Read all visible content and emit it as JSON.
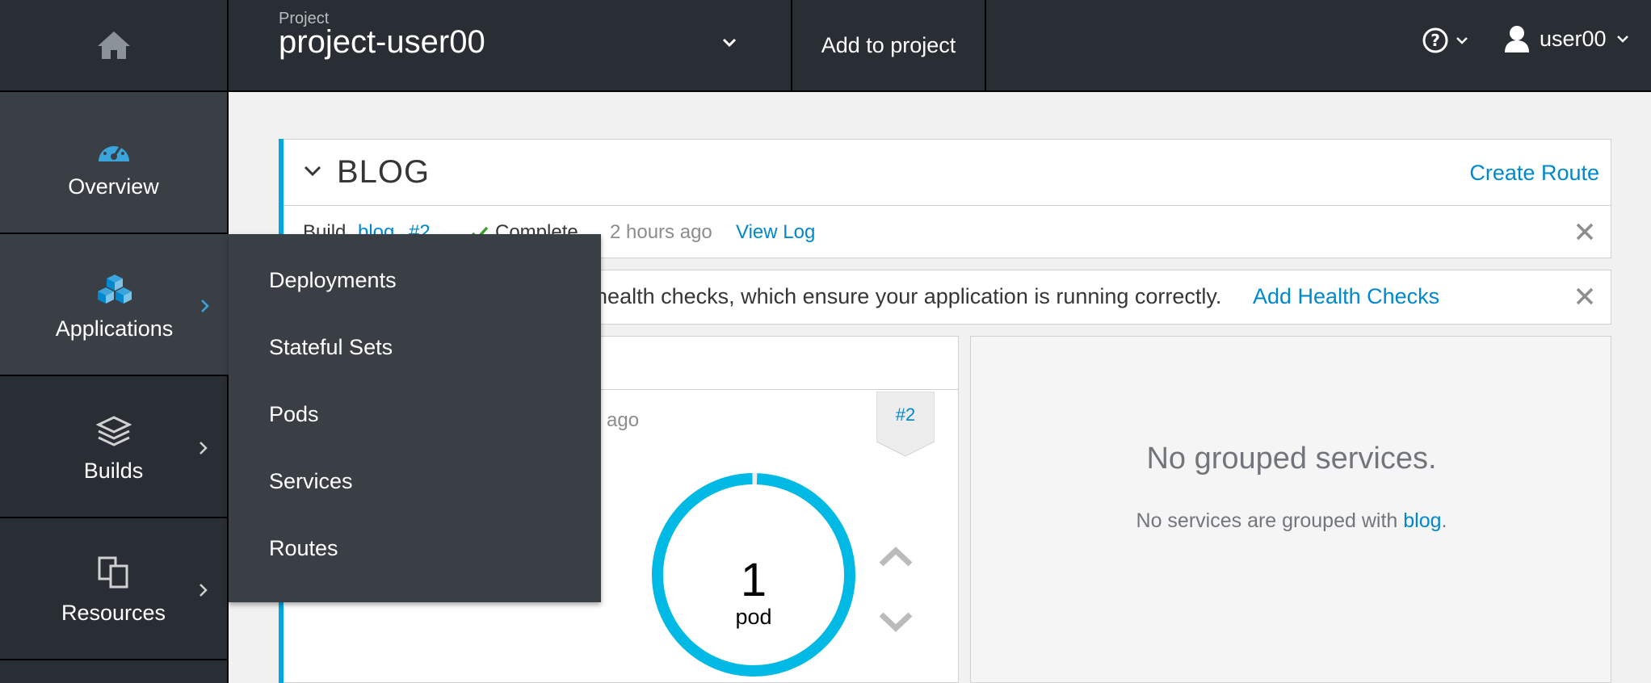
{
  "header": {
    "project_caption": "Project",
    "project_name": "project-user00",
    "add_to_project": "Add to project",
    "username": "user00"
  },
  "sidebar": {
    "items": [
      {
        "label": "Overview",
        "icon": "dashboard-icon"
      },
      {
        "label": "Applications",
        "icon": "cubes-icon"
      },
      {
        "label": "Builds",
        "icon": "layers-icon"
      },
      {
        "label": "Resources",
        "icon": "copy-icon"
      }
    ]
  },
  "flyout": {
    "items": [
      "Deployments",
      "Stateful Sets",
      "Pods",
      "Services",
      "Routes"
    ]
  },
  "app": {
    "title": "BLOG",
    "create_route": "Create Route",
    "build": {
      "prefix": "Build",
      "name": "blog",
      "number": "#2",
      "status": "Complete",
      "time": "2 hours ago",
      "view_log": "View Log"
    },
    "health_message": "out health checks, which ensure your application is running correctly.",
    "health_link": "Add Health Checks",
    "deployment": {
      "ago": "ago",
      "version": "#2",
      "pod_count": "1",
      "pod_label": "pod",
      "pod_ring_fill": 1.0
    },
    "grouped": {
      "title": "No grouped services.",
      "sub_prefix": "No services are grouped with ",
      "sub_link": "blog",
      "sub_suffix": "."
    }
  },
  "colors": {
    "accent": "#00a8e1",
    "link": "#0088ce",
    "nav_bg": "#292e34",
    "nav_active": "#393f44",
    "success": "#3f9c35"
  }
}
